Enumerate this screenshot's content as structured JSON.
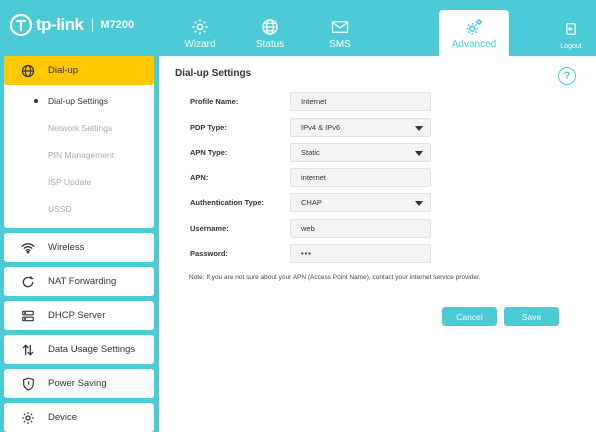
{
  "brand": {
    "name": "tp-link",
    "model": "M7200"
  },
  "nav": {
    "tabs": [
      {
        "label": "Wizard",
        "icon": "gear-icon"
      },
      {
        "label": "Status",
        "icon": "globe-icon"
      },
      {
        "label": "SMS",
        "icon": "envelope-icon"
      },
      {
        "label": "Advanced",
        "icon": "gears-icon"
      }
    ],
    "active_tab": "Advanced",
    "logout_label": "Logout"
  },
  "sidebar": {
    "items": [
      {
        "label": "Dial-up",
        "icon": "globe-icon",
        "active": true,
        "subitems": [
          {
            "label": "Dial-up Settings",
            "active": true
          },
          {
            "label": "Network Settings"
          },
          {
            "label": "PIN Management"
          },
          {
            "label": "ISP Update"
          },
          {
            "label": "USSD"
          }
        ]
      },
      {
        "label": "Wireless",
        "icon": "wifi-icon"
      },
      {
        "label": "NAT Forwarding",
        "icon": "nat-icon"
      },
      {
        "label": "DHCP Server",
        "icon": "server-icon"
      },
      {
        "label": "Data Usage Settings",
        "icon": "arrows-icon"
      },
      {
        "label": "Power Saving",
        "icon": "shield-icon"
      },
      {
        "label": "Device",
        "icon": "gear-icon"
      }
    ]
  },
  "panel": {
    "title": "Dial-up Settings",
    "fields": {
      "profile_name": {
        "label": "Profile Name:",
        "value": "Internet"
      },
      "pdp_type": {
        "label": "PDP Type:",
        "value": "IPv4 & IPv6"
      },
      "apn_type": {
        "label": "APN Type:",
        "value": "Static"
      },
      "apn": {
        "label": "APN:",
        "value": "internet"
      },
      "auth_type": {
        "label": "Authentication Type:",
        "value": "CHAP"
      },
      "username": {
        "label": "Username:",
        "value": "web"
      },
      "password": {
        "label": "Password:",
        "value": "•••"
      }
    },
    "note": "Note: If you are not sure about your APN (Access Point Name), contact your internet service provider.",
    "cancel_label": "Cancel",
    "save_label": "Save"
  },
  "colors": {
    "accent": "#4acbd6",
    "active_menu": "#ffc800",
    "panel": "#ffffff"
  }
}
